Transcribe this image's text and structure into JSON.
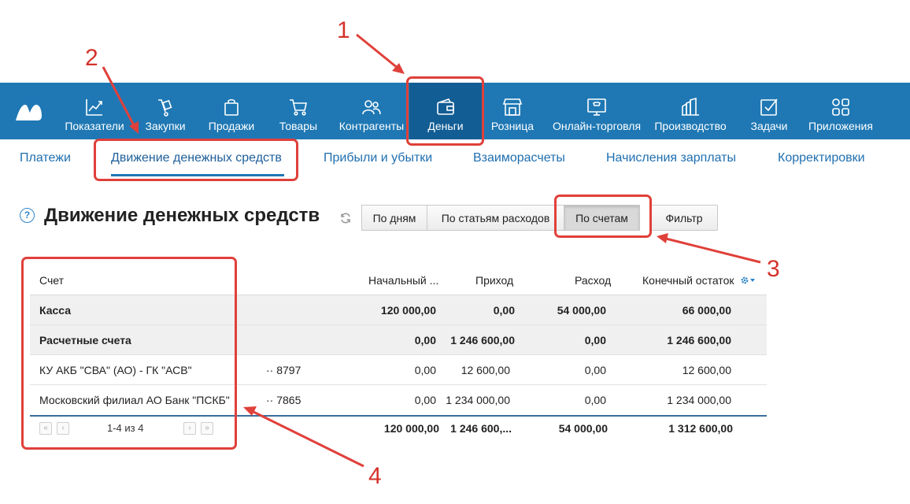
{
  "nav": {
    "items": [
      {
        "label": "Показатели",
        "icon": "chart-line-icon"
      },
      {
        "label": "Закупки",
        "icon": "cart-dolly-icon"
      },
      {
        "label": "Продажи",
        "icon": "shopping-bag-icon"
      },
      {
        "label": "Товары",
        "icon": "cart-icon"
      },
      {
        "label": "Контрагенты",
        "icon": "users-icon"
      },
      {
        "label": "Деньги",
        "icon": "wallet-icon"
      },
      {
        "label": "Розница",
        "icon": "store-icon"
      },
      {
        "label": "Онлайн-торговля",
        "icon": "online-store-icon"
      },
      {
        "label": "Производство",
        "icon": "factory-icon"
      },
      {
        "label": "Задачи",
        "icon": "checkbox-icon"
      },
      {
        "label": "Приложения",
        "icon": "apps-icon"
      }
    ],
    "active": "Деньги"
  },
  "subnav": {
    "items": [
      "Платежи",
      "Движение денежных средств",
      "Прибыли и убытки",
      "Взаиморасчеты",
      "Начисления зарплаты",
      "Корректировки"
    ],
    "active": "Движение денежных средств"
  },
  "page": {
    "title": "Движение денежных средств",
    "help": "?"
  },
  "view_buttons": {
    "by_days": "По дням",
    "by_expense_items": "По статьям расходов",
    "by_accounts": "По счетам",
    "filter": "Фильтр"
  },
  "table": {
    "headers": {
      "account": "Счет",
      "opening": "Начальный ...",
      "income": "Приход",
      "expense": "Расход",
      "closing": "Конечный остаток"
    },
    "rows": [
      {
        "name": "Касса",
        "number": "",
        "opening": "120 000,00",
        "income": "0,00",
        "expense": "54 000,00",
        "closing": "66 000,00",
        "group": true
      },
      {
        "name": "Расчетные счета",
        "number": "",
        "opening": "0,00",
        "income": "1 246 600,00",
        "expense": "0,00",
        "closing": "1 246 600,00",
        "group": true
      },
      {
        "name": "КУ АКБ \"СВА\" (АО) - ГК \"АСВ\"",
        "number": "·· 8797",
        "opening": "0,00",
        "income": "12 600,00",
        "expense": "0,00",
        "closing": "12 600,00",
        "group": false
      },
      {
        "name": "Московский филиал АО Банк \"ПСКБ\"",
        "number": "·· 7865",
        "opening": "0,00",
        "income": "1 234 000,00",
        "expense": "0,00",
        "closing": "1 234 000,00",
        "group": false
      }
    ],
    "footer": {
      "pagination": "1-4 из 4",
      "opening": "120 000,00",
      "income": "1 246 600,...",
      "expense": "54 000,00",
      "closing": "1 312 600,00"
    }
  },
  "annotations": {
    "n1": "1",
    "n2": "2",
    "n3": "3",
    "n4": "4",
    "color": "#e0403a"
  },
  "colors": {
    "nav_bg": "#1f78b4",
    "nav_active": "#125d94",
    "link": "#1f6fb0"
  }
}
